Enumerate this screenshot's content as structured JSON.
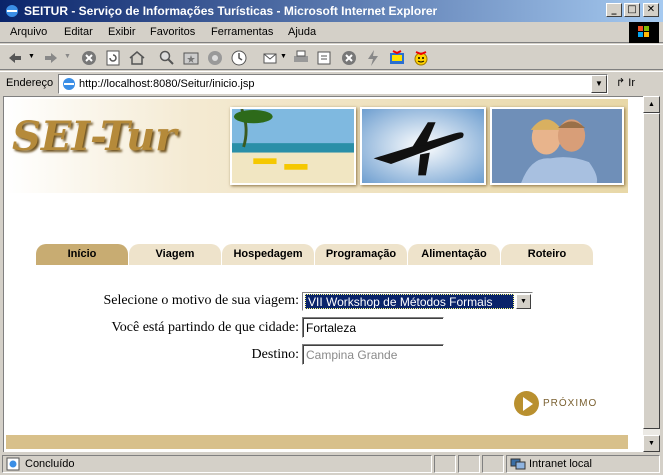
{
  "window": {
    "title": "SEITUR - Serviço de Informações Turísticas - Microsoft Internet Explorer",
    "minimize": "_",
    "maximize": "□",
    "close": "✕"
  },
  "menu": [
    "Arquivo",
    "Editar",
    "Exibir",
    "Favoritos",
    "Ferramentas",
    "Ajuda"
  ],
  "address": {
    "label": "Endereço",
    "url": "http://localhost:8080/Seitur/inicio.jsp",
    "go_label": "Ir"
  },
  "site": {
    "logo": "SEI-Tur",
    "tabs": [
      {
        "label": "Início",
        "active": true
      },
      {
        "label": "Viagem",
        "active": false
      },
      {
        "label": "Hospedagem",
        "active": false
      },
      {
        "label": "Programação",
        "active": false
      },
      {
        "label": "Alimentação",
        "active": false
      },
      {
        "label": "Roteiro",
        "active": false
      }
    ],
    "form": {
      "reason_label": "Selecione o motivo de sua viagem:",
      "reason_value": "VII Workshop de Métodos Formais",
      "origin_label": "Você está partindo de que cidade:",
      "origin_value": "Fortaleza",
      "destination_label": "Destino:",
      "destination_value": "Campina Grande"
    },
    "next_label": "PRÓXIMO"
  },
  "status": {
    "text": "Concluído",
    "zone": "Intranet local"
  },
  "colors": {
    "tab_active": "#c8ac72",
    "tab_inactive": "#eee3cb",
    "brand_gold": "#b58a3a",
    "title_bar": "#0a246a"
  }
}
